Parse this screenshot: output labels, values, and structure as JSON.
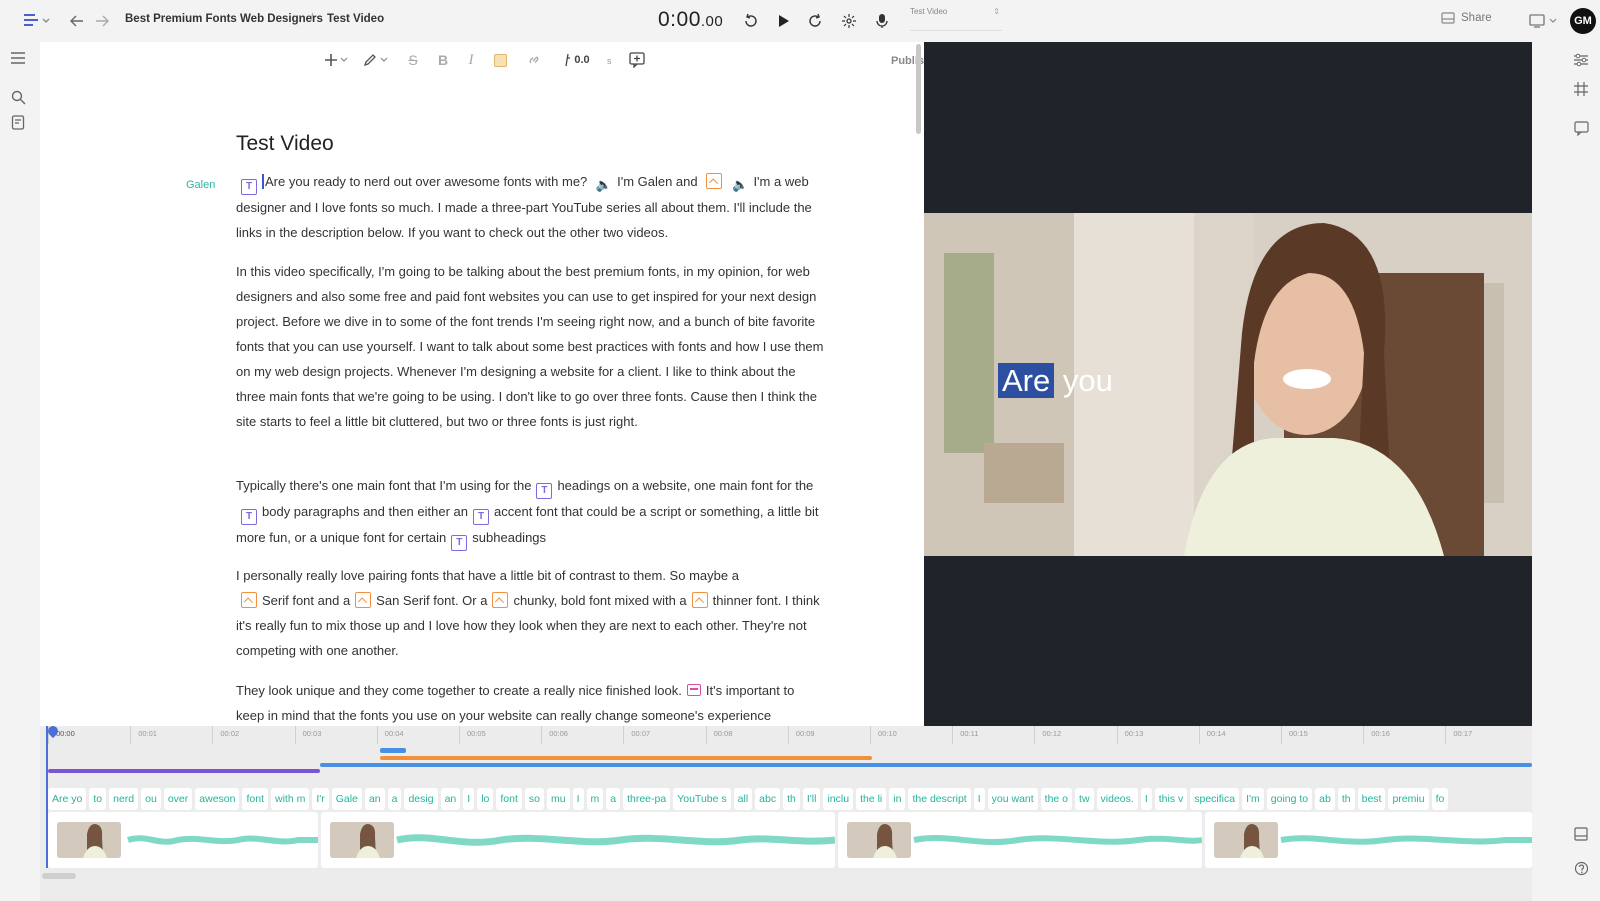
{
  "breadcrumb": {
    "project": "Best Premium Fonts Web Designers",
    "separator": "/",
    "current": "Test Video"
  },
  "transport": {
    "timer_main": "0:00",
    "timer_frac": ".00"
  },
  "composition": {
    "label": "Test Video"
  },
  "header": {
    "share_label": "Share",
    "avatar_initials": "GM"
  },
  "toolbar": {
    "gap_value": "0.0",
    "gap_unit": "s",
    "publish_label": "Publish"
  },
  "document": {
    "title": "Test Video",
    "speaker": "Galen",
    "p1": {
      "a": "Are you ready to nerd out over awesome fonts with me?",
      "b": "I'm Galen and",
      "c": "I'm a",
      "d": "web designer and I love fonts so much. I made a three-part YouTube series all about them. I'll include the links in the description below. If you want to check out the other two videos."
    },
    "p2": "In this video specifically, I'm going to be talking about the best premium fonts, in my opinion, for web designers and also some free and paid font websites you can use to get inspired for your next design project. Before we dive in to some of the font trends I'm seeing right now, and a bunch of bite favorite fonts that you can use yourself. I want to talk about some best practices with fonts and how I use them on my web design projects. Whenever I'm designing a website for a client. I like to think about the three main fonts that we're going to be using. I don't like to go over three fonts. Cause then I think the site starts to feel a little bit cluttered, but two or three fonts is just right.",
    "p3": {
      "a": "Typically there's one main font that I'm using for the",
      "b": "headings on a website, one main font for the",
      "c": "body paragraphs and then either an",
      "d": "accent font that could be a script or something, a little bit more fun, or a unique font for certain",
      "e": "subheadings"
    },
    "p4": {
      "a": "I personally really love pairing fonts that have a little bit of contrast to them. So maybe a",
      "b": "Serif font and a",
      "c": "San Serif font. Or a",
      "d": "chunky, bold font mixed with a",
      "e": "thinner",
      "f": "font. I think it's really fun to mix those up and I love how they look when they are next to each other. They're not competing with one another."
    },
    "p5": {
      "a": "They look unique and they come together to create a really nice finished look.",
      "b": "It's important to keep in mind that the fonts you use on your website can really change someone's experience"
    }
  },
  "preview": {
    "caption_highlight": "Are",
    "caption_rest": "you"
  },
  "timeline": {
    "ticks": [
      "00:00",
      "00:01",
      "00:02",
      "00:03",
      "00:04",
      "00:05",
      "00:06",
      "00:07",
      "00:08",
      "00:09",
      "00:10",
      "00:11",
      "00:12",
      "00:13",
      "00:14",
      "00:15",
      "00:16",
      "00:17"
    ],
    "words": [
      "Are yo",
      "to",
      "nerd",
      "ou",
      "over",
      "aweson",
      "font",
      "with m",
      "I'r",
      "Gale",
      "an",
      "a",
      "desig",
      "an",
      "I",
      "lo",
      "font",
      "so",
      "mu",
      "I",
      "m",
      "a",
      "three-pa",
      "YouTube s",
      "all",
      "abc",
      "th",
      "I'll",
      "inclu",
      "the li",
      "in",
      "the descript",
      "I",
      "you want",
      "the o",
      "tw",
      "videos.",
      "I",
      "this v",
      "specifica",
      "I'm",
      "going to",
      "ab",
      "th",
      "best",
      "premiu",
      "fo"
    ],
    "colors": {
      "purple": "#7a55d6",
      "orange": "#f0913e",
      "blue": "#4a90e2",
      "teal": "#25b39e",
      "playhead": "#4b6fd6"
    }
  }
}
